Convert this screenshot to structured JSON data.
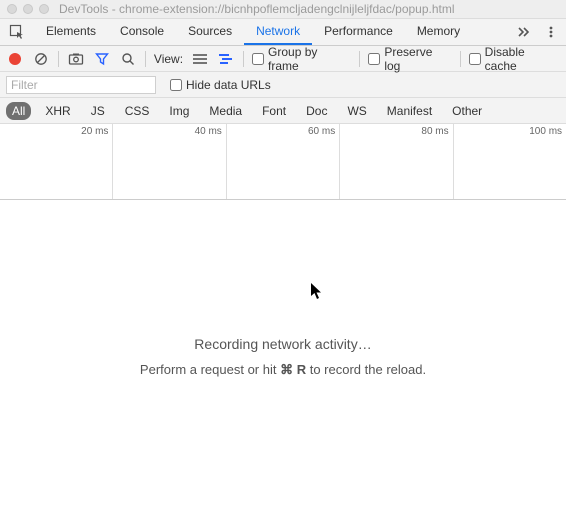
{
  "window": {
    "title": "DevTools - chrome-extension://bicnhpoflemcljadengclnijleljfdac/popup.html"
  },
  "tabs": {
    "elements": "Elements",
    "console": "Console",
    "sources": "Sources",
    "network": "Network",
    "performance": "Performance",
    "memory": "Memory"
  },
  "toolbar": {
    "view_label": "View:",
    "group_by_frame": "Group by frame",
    "preserve_log": "Preserve log",
    "disable_cache": "Disable cache"
  },
  "filterbar": {
    "placeholder": "Filter",
    "hide_data_urls": "Hide data URLs"
  },
  "types": {
    "all": "All",
    "xhr": "XHR",
    "js": "JS",
    "css": "CSS",
    "img": "Img",
    "media": "Media",
    "font": "Font",
    "doc": "Doc",
    "ws": "WS",
    "manifest": "Manifest",
    "other": "Other"
  },
  "timeline": {
    "t20": "20 ms",
    "t40": "40 ms",
    "t60": "60 ms",
    "t80": "80 ms",
    "t100": "100 ms"
  },
  "empty": {
    "line1": "Recording network activity…",
    "line2_pre": "Perform a request or hit ",
    "shortcut_sym": "⌘",
    "shortcut_key": "R",
    "line2_post": " to record the reload."
  }
}
